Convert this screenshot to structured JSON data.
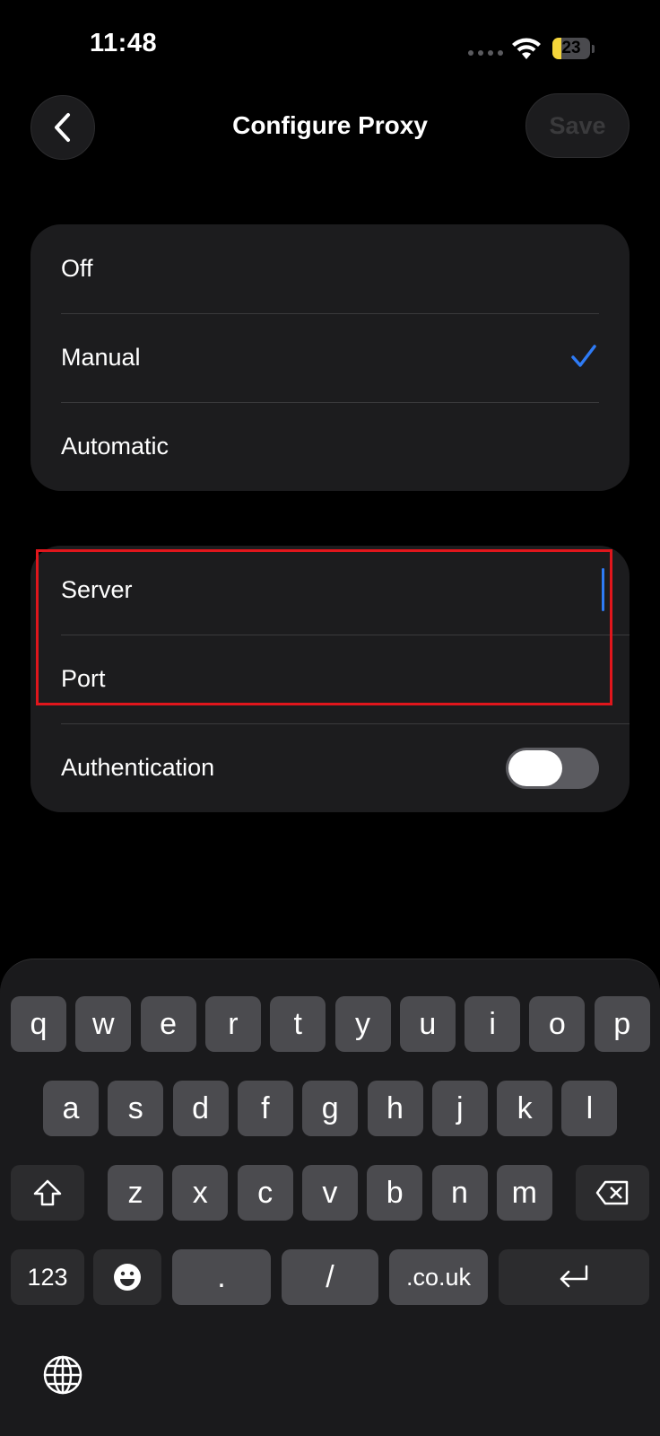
{
  "status_bar": {
    "time": "11:48",
    "battery_level": "23"
  },
  "nav": {
    "title": "Configure Proxy",
    "save_label": "Save",
    "back_icon": "chevron-left-icon"
  },
  "proxy_mode": {
    "options": [
      {
        "label": "Off",
        "selected": false
      },
      {
        "label": "Manual",
        "selected": true
      },
      {
        "label": "Automatic",
        "selected": false
      }
    ],
    "accent_color": "#2e7bf6"
  },
  "manual_fields": {
    "server_label": "Server",
    "port_label": "Port",
    "authentication_label": "Authentication",
    "authentication_enabled": false
  },
  "keyboard": {
    "row1": [
      "q",
      "w",
      "e",
      "r",
      "t",
      "y",
      "u",
      "i",
      "o",
      "p"
    ],
    "row2": [
      "a",
      "s",
      "d",
      "f",
      "g",
      "h",
      "j",
      "k",
      "l"
    ],
    "row3": [
      "z",
      "x",
      "c",
      "v",
      "b",
      "n",
      "m"
    ],
    "numbers_key": "123",
    "dot_key": ".",
    "slash_key": "/",
    "domain_key": ".co.uk"
  },
  "colors": {
    "highlight_border": "#e0161c",
    "battery_fill": "#f5d53a"
  }
}
